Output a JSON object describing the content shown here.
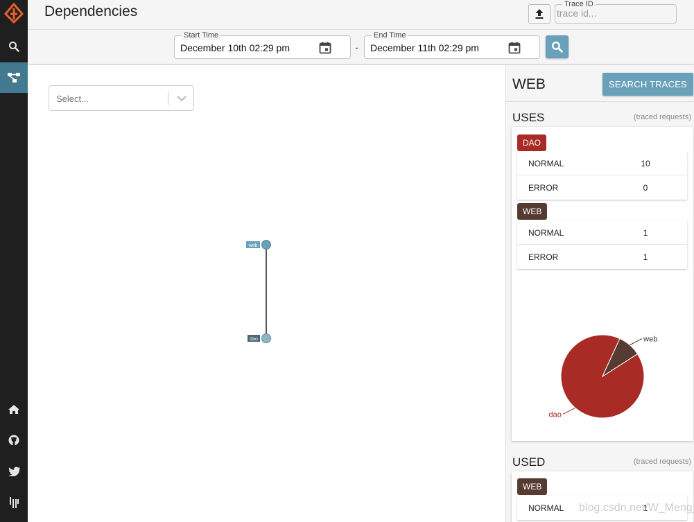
{
  "header": {
    "title": "Dependencies",
    "upload_icon": "upload-icon",
    "trace_id_label": "Trace ID",
    "trace_id_placeholder": "trace id...",
    "trace_id_value": ""
  },
  "timebar": {
    "start_label": "Start Time",
    "start_value": "December 10th 02:29 pm",
    "separator": "-",
    "end_label": "End Time",
    "end_value": "December 11th 02:29 pm",
    "calendar_icon": "calendar-icon",
    "search_icon": "search-icon"
  },
  "sidebar": {
    "items": [
      {
        "icon": "zipkin-logo-icon"
      },
      {
        "icon": "search-icon"
      },
      {
        "icon": "dependencies-icon",
        "active": true
      },
      {
        "icon": "home-icon"
      },
      {
        "icon": "github-icon"
      },
      {
        "icon": "twitter-icon"
      },
      {
        "icon": "gitter-icon"
      }
    ]
  },
  "graph": {
    "select_placeholder": "Select...",
    "nodes": [
      {
        "name": "web"
      },
      {
        "name": "dao"
      }
    ],
    "edges": [
      [
        "web",
        "dao"
      ]
    ]
  },
  "panel": {
    "title": "WEB",
    "search_traces_label": "SEARCH TRACES",
    "uses": {
      "title": "USES",
      "note": "(traced requests)",
      "services": [
        {
          "name": "DAO",
          "color": "#a82b26",
          "rows": [
            {
              "label": "NORMAL",
              "value": "10"
            },
            {
              "label": "ERROR",
              "value": "0"
            }
          ]
        },
        {
          "name": "WEB",
          "color": "#553b31",
          "rows": [
            {
              "label": "NORMAL",
              "value": "1"
            },
            {
              "label": "ERROR",
              "value": "1"
            }
          ]
        }
      ],
      "pie": [
        {
          "label": "dao",
          "value": 10,
          "color": "#a82b26"
        },
        {
          "label": "web",
          "value": 1,
          "color": "#553b31"
        }
      ]
    },
    "used": {
      "title": "USED",
      "note": "(traced requests)",
      "services": [
        {
          "name": "WEB",
          "color": "#553b31",
          "rows": [
            {
              "label": "NORMAL",
              "value": "1"
            }
          ]
        }
      ]
    }
  },
  "watermark": "blog.csdn.net/W_Meng_H",
  "colors": {
    "accent": "#6aa1ba",
    "sidebar": "#1f1f1f",
    "active": "#437a91"
  }
}
